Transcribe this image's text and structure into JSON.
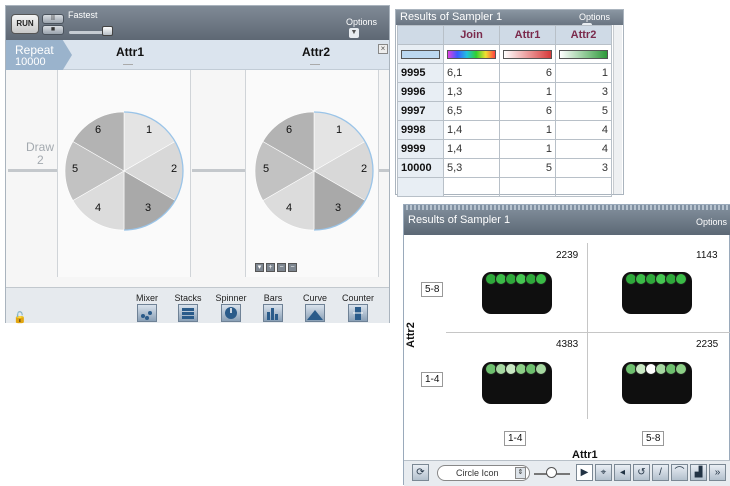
{
  "sampler": {
    "run_label": "RUN",
    "pause_label": "II",
    "stop_label": "■",
    "speed_label": "Fastest",
    "options_label": "Options",
    "repeat_label": "Repeat",
    "repeat_value": "10000",
    "attr1_title": "Attr1",
    "attr2_title": "Attr2",
    "close_label": "×",
    "draw_label": "Draw",
    "draw_value": "2",
    "spinner1_labels": [
      "1",
      "2",
      "3",
      "4",
      "5",
      "6"
    ],
    "spinner2_labels": [
      "1",
      "2",
      "3",
      "4",
      "5",
      "6"
    ],
    "mini_controls": [
      "▾",
      "+",
      "−",
      "−"
    ],
    "devices": [
      {
        "label": "Mixer",
        "icon": "mixer-icon"
      },
      {
        "label": "Stacks",
        "icon": "stacks-icon"
      },
      {
        "label": "Spinner",
        "icon": "spinner-icon"
      },
      {
        "label": "Bars",
        "icon": "bars-icon"
      },
      {
        "label": "Curve",
        "icon": "curve-icon"
      },
      {
        "label": "Counter",
        "icon": "counter-icon"
      }
    ],
    "lock_icon": "lock-icon"
  },
  "results": {
    "title": "Results of Sampler 1",
    "options_label": "Options",
    "columns": [
      "Join",
      "Attr1",
      "Attr2"
    ],
    "swatch_colors": [
      "#bcd8f0",
      "rainbow",
      "#d73a3a",
      "#2f9a3a"
    ],
    "rows": [
      {
        "index": "9995",
        "join": "6,1",
        "attr1": "6",
        "attr2": "1"
      },
      {
        "index": "9996",
        "join": "1,3",
        "attr1": "1",
        "attr2": "3"
      },
      {
        "index": "9997",
        "join": "6,5",
        "attr1": "6",
        "attr2": "5"
      },
      {
        "index": "9998",
        "join": "1,4",
        "attr1": "1",
        "attr2": "4"
      },
      {
        "index": "9999",
        "join": "1,4",
        "attr1": "1",
        "attr2": "4"
      },
      {
        "index": "10000",
        "join": "5,3",
        "attr1": "5",
        "attr2": "3"
      }
    ]
  },
  "plot": {
    "title": "Results of Sampler 1",
    "options_label": "Options",
    "x_label": "Attr1",
    "y_label": "Attr2",
    "x_categories": [
      "1-4",
      "5-8"
    ],
    "y_categories": [
      "5-8",
      "1-4"
    ],
    "counts": {
      "top_left": "2239",
      "top_right": "1143",
      "bottom_left": "4383",
      "bottom_right": "2235"
    },
    "icon_type": "Circle Icon",
    "tools": [
      "▶",
      "⌖",
      "◂",
      "↺",
      "/",
      "⌒",
      "▟",
      "»"
    ]
  }
}
